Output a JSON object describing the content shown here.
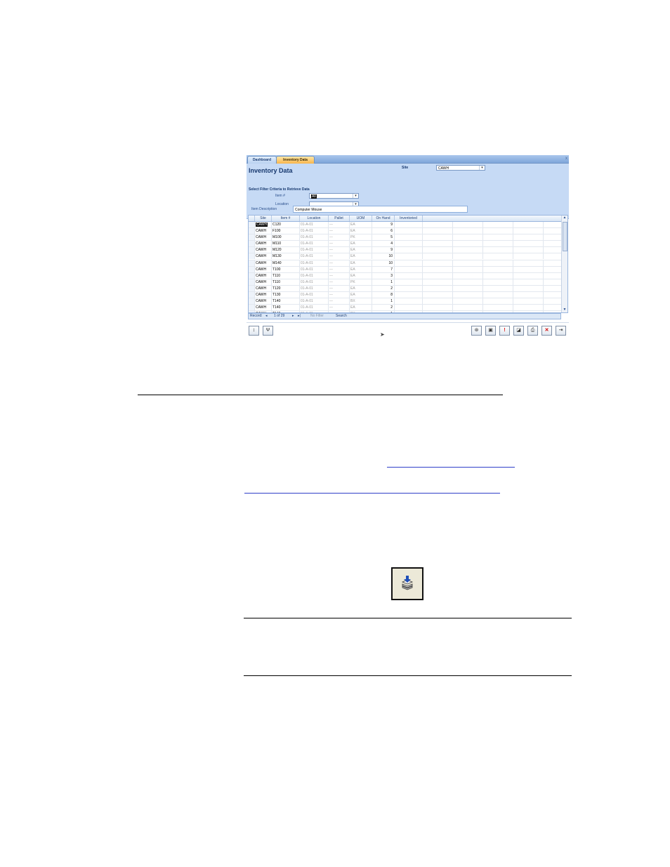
{
  "tabs": {
    "dashboard": "Dashboard",
    "inventory": "Inventory Data",
    "close": "x"
  },
  "form": {
    "title": "Inventory Data",
    "site_label": "Site",
    "site_value": "CAWH",
    "filter_title": "Select Filter Criteria to Retrieve Data",
    "item_label": "Item #",
    "item_value": "All",
    "location_label": "Location",
    "location_value": "",
    "desc_label": "Item Description",
    "desc_value": "Computer Mouse"
  },
  "grid": {
    "columns": [
      "Site",
      "Item #",
      "Location",
      "Pallet",
      "UOM",
      "On Hand",
      "Inventoried"
    ],
    "rows": [
      [
        "CAWH",
        "C120",
        "01-A-01",
        "---",
        "EA",
        "9"
      ],
      [
        "CAWH",
        "F100",
        "01-A-01",
        "---",
        "EA",
        "6"
      ],
      [
        "CAWH",
        "M100",
        "01-A-01",
        "---",
        "PK",
        "5"
      ],
      [
        "CAWH",
        "M110",
        "01-A-01",
        "---",
        "EA",
        "4"
      ],
      [
        "CAWH",
        "M120",
        "01-A-01",
        "---",
        "EA",
        "9"
      ],
      [
        "CAWH",
        "M130",
        "01-A-01",
        "---",
        "EA",
        "10"
      ],
      [
        "CAWH",
        "M140",
        "01-A-01",
        "---",
        "EA",
        "10"
      ],
      [
        "CAWH",
        "T100",
        "01-A-01",
        "---",
        "EA",
        "7"
      ],
      [
        "CAWH",
        "T110",
        "01-A-01",
        "---",
        "EA",
        "3"
      ],
      [
        "CAWH",
        "T110",
        "01-A-01",
        "---",
        "PK",
        "1"
      ],
      [
        "CAWH",
        "T120",
        "01-A-01",
        "---",
        "EA",
        "2"
      ],
      [
        "CAWH",
        "T130",
        "01-A-01",
        "---",
        "EA",
        "8"
      ],
      [
        "CAWH",
        "T140",
        "01-A-01",
        "---",
        "BX",
        "1"
      ],
      [
        "CAWH",
        "T140",
        "01-A-01",
        "---",
        "EA",
        "2"
      ],
      [
        "CAWH",
        "T140",
        "01-A-01",
        "---",
        "PK",
        "1"
      ],
      [
        "CAWH",
        "T150",
        "01-A-01",
        "---",
        "EA",
        "8"
      ]
    ]
  },
  "navbar": {
    "record_label": "Record:",
    "position": "1 of 29",
    "no_filter": "No Filter",
    "search": "Search"
  },
  "toolbar_left": [
    "sort-icon",
    "filter-icon"
  ],
  "toolbar_right": [
    "link-icon",
    "save-icon",
    "alert-icon",
    "preview-icon",
    "print-icon",
    "delete-icon",
    "exit-icon"
  ]
}
